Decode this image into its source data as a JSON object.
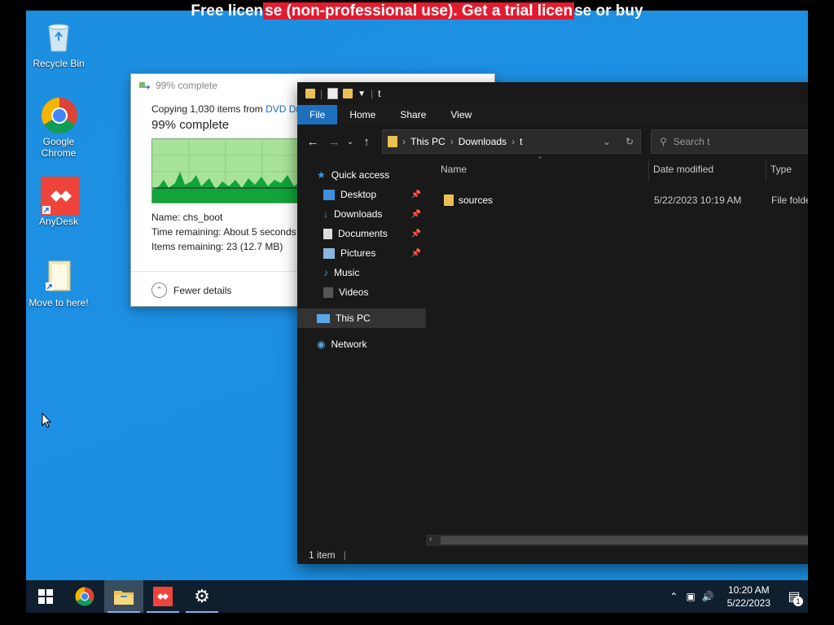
{
  "banner": {
    "pre": "Free licen",
    "hl1": "se (non-professional use). Get a trial licen",
    "post": "se or buy"
  },
  "desktop": {
    "icons": [
      {
        "label": "Recycle Bin",
        "icon": "recycle-bin-icon"
      },
      {
        "label": "Google Chrome",
        "icon": "chrome-icon"
      },
      {
        "label": "AnyDesk",
        "icon": "anydesk-icon"
      },
      {
        "label": "Move to here!",
        "icon": "folder-shortcut-icon"
      }
    ]
  },
  "copy_dialog": {
    "title": "99% complete",
    "copying_prefix": "Copying 1,030 items from ",
    "copying_source": "DVD Dr",
    "percent_text": "99% complete",
    "name_line": "Name:  chs_boot",
    "time_line": "Time remaining:  About 5 seconds",
    "items_line": "Items remaining:  23 (12.7 MB)",
    "fewer_details": "Fewer details",
    "progress": 0.99
  },
  "explorer": {
    "title": "t",
    "ribbon_tabs": [
      "File",
      "Home",
      "Share",
      "View"
    ],
    "breadcrumb": [
      "This PC",
      "Downloads",
      "t"
    ],
    "search_placeholder": "Search t",
    "nav": {
      "quick_access": "Quick access",
      "items": [
        "Desktop",
        "Downloads",
        "Documents",
        "Pictures",
        "Music",
        "Videos"
      ],
      "this_pc": "This PC",
      "network": "Network"
    },
    "columns": {
      "name": "Name",
      "date": "Date modified",
      "type": "Type"
    },
    "files": [
      {
        "name": "sources",
        "date": "5/22/2023 10:19 AM",
        "type": "File folde"
      }
    ],
    "status": "1 item"
  },
  "taskbar": {
    "time": "10:20 AM",
    "date": "5/22/2023",
    "notification_count": "1"
  }
}
